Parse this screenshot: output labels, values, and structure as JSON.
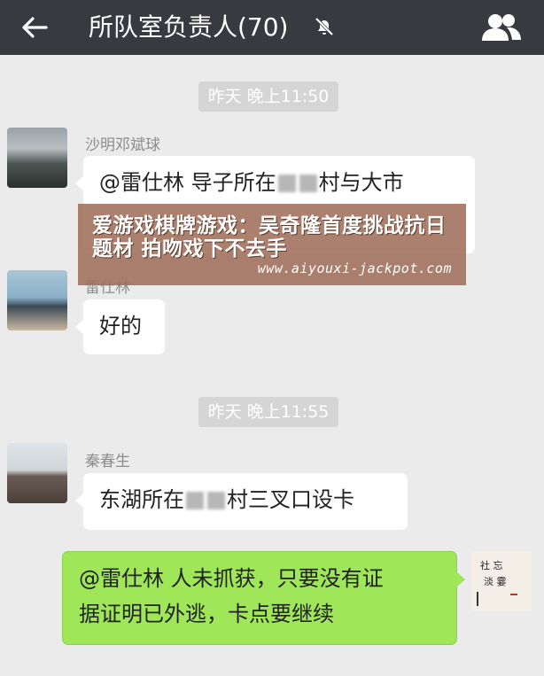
{
  "header": {
    "back_icon": "arrow-left-icon",
    "title": "所队室负责人(70)",
    "mute_icon": "bell-off-icon",
    "members_icon": "people-icon"
  },
  "messages": [
    {
      "type": "time",
      "text": "昨天 晚上11:50"
    },
    {
      "type": "msg",
      "sender": "沙明邓斌球",
      "text_before": "@雷仕林  导子所在",
      "text_after": "村与大市",
      "text_line2": "...",
      "blurred": true
    },
    {
      "type": "msg",
      "sender": "雷仕林",
      "text": "好的"
    },
    {
      "type": "time",
      "text": "昨天 晚上11:55"
    },
    {
      "type": "msg",
      "sender": "秦春生",
      "text_before": "东湖所在",
      "text_after": "村三叉口设卡",
      "blurred": true
    },
    {
      "type": "self",
      "line1": "@雷仕林  人未抓获，只要没有证",
      "line2": "据证明已外逃，卡点要继续"
    }
  ],
  "overlay": {
    "headline": "爱游戏棋牌游戏：吴奇隆首度挑战抗日题材 拍吻戏下不去手",
    "url": "www.aiyouxi-jackpot.com"
  },
  "colors": {
    "topbar": "#393a3f",
    "background": "#ebebeb",
    "self_bubble": "#9fe658"
  }
}
